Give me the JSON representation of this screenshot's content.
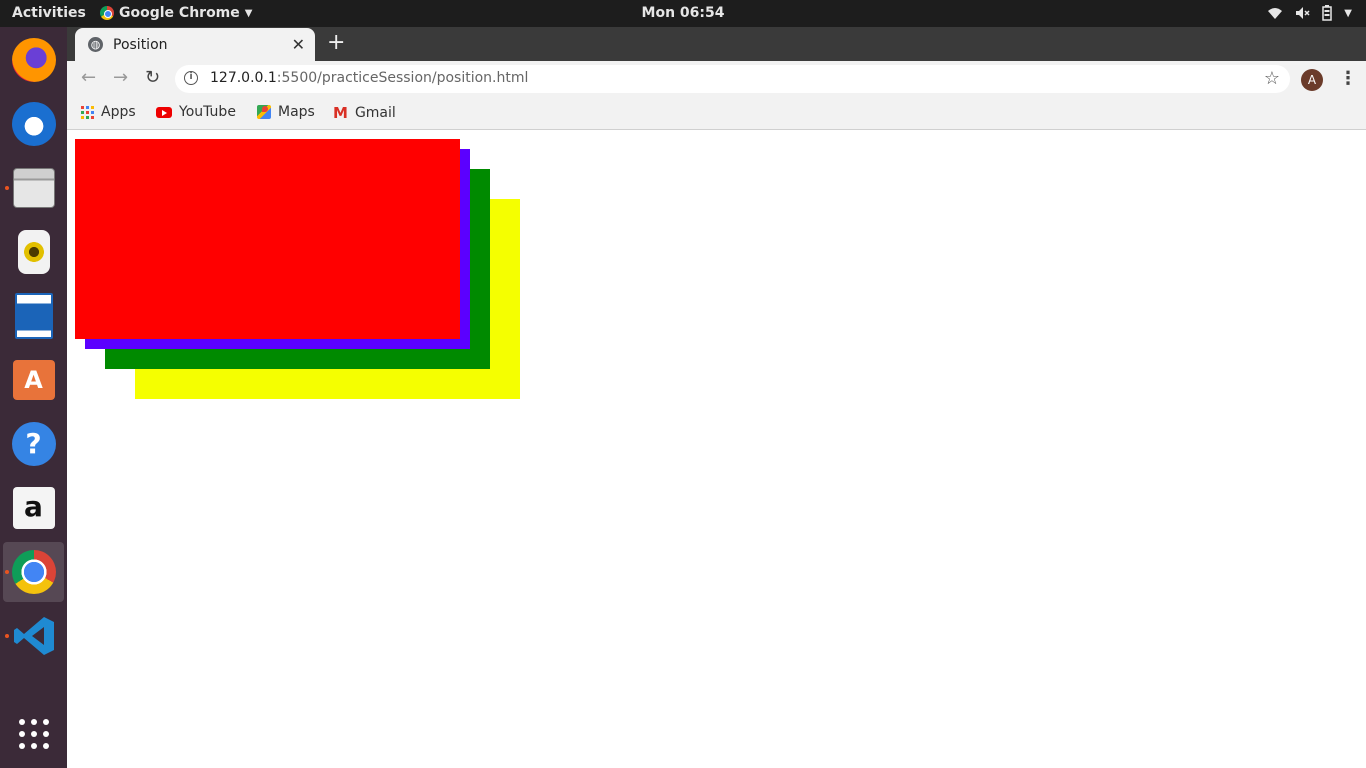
{
  "topbar": {
    "activities": "Activities",
    "app_name": "Google Chrome",
    "clock": "Mon 06:54"
  },
  "dock": {
    "apps": [
      "firefox-icon",
      "thunderbird-icon",
      "files-icon",
      "rhythmbox-icon",
      "writer-icon",
      "software-icon",
      "help-icon",
      "amazon-icon",
      "chrome-icon",
      "vscode-icon",
      "show-apps-icon"
    ],
    "active": "chrome-icon"
  },
  "browser": {
    "tab": {
      "title": "Position",
      "close": "✕"
    },
    "new_tab": "+",
    "url_host": "127.0.0.1",
    "url_path": ":5500/practiceSession/position.html",
    "profile_initial": "A",
    "bookmarks": [
      "Apps",
      "YouTube",
      "Maps",
      "Gmail"
    ]
  },
  "page": {
    "boxes": [
      {
        "name": "yellow-box",
        "color": "#f5ff00"
      },
      {
        "name": "green-box",
        "color": "#008a00"
      },
      {
        "name": "purple-box",
        "color": "#5b00ff"
      },
      {
        "name": "red-box",
        "color": "#ff0000"
      }
    ]
  }
}
